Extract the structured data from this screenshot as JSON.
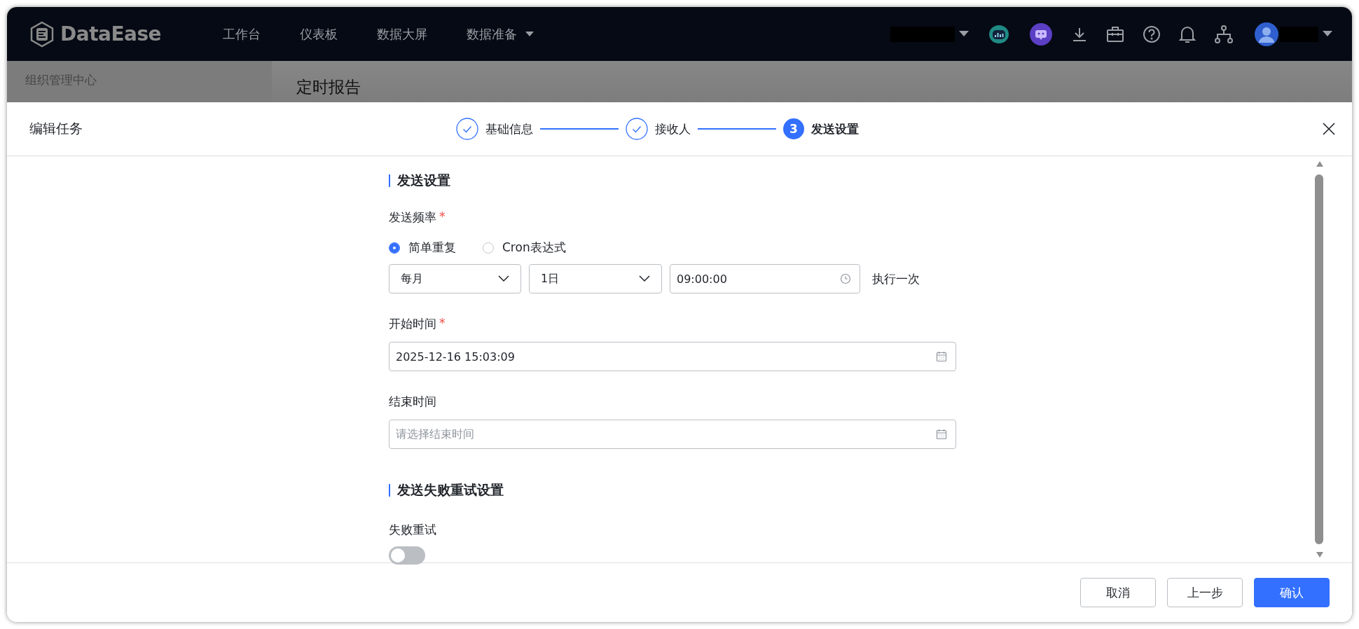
{
  "nav": {
    "logo": "DataEase",
    "items": [
      {
        "label": "工作台",
        "dropdown": false
      },
      {
        "label": "仪表板",
        "dropdown": false
      },
      {
        "label": "数据大屏",
        "dropdown": false
      },
      {
        "label": "数据准备",
        "dropdown": true
      }
    ]
  },
  "background": {
    "sidebar_title": "组织管理中心",
    "page_title": "定时报告"
  },
  "dialog": {
    "title": "编辑任务",
    "steps": [
      {
        "label": "基础信息",
        "kind": "done"
      },
      {
        "label": "接收人",
        "kind": "done"
      },
      {
        "label": "发送设置",
        "kind": "active",
        "number": "3"
      }
    ]
  },
  "form": {
    "section_title": "发送设置",
    "frequency": {
      "label": "发送频率",
      "required_mark": "*",
      "options": [
        {
          "label": "简单重复",
          "selected": true
        },
        {
          "label": "Cron表达式",
          "selected": false
        }
      ],
      "period": "每月",
      "day": "1日",
      "time": "09:00:00",
      "suffix": "执行一次"
    },
    "start_time": {
      "label": "开始时间",
      "required_mark": "*",
      "value": "2025-12-16 15:03:09"
    },
    "end_time": {
      "label": "结束时间",
      "placeholder": "请选择结束时间"
    },
    "retry_section_title": "发送失败重试设置",
    "retry": {
      "label": "失败重试",
      "on": false
    }
  },
  "footer": {
    "buttons": [
      {
        "label": "取消",
        "kind": "default"
      },
      {
        "label": "上一步",
        "kind": "default"
      },
      {
        "label": "确认",
        "kind": "primary"
      }
    ]
  }
}
